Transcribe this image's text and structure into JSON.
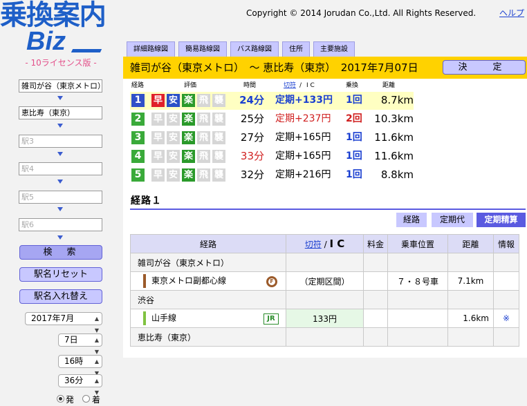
{
  "logo": {
    "main": "乗換案内",
    "sub": "Biz",
    "license": "- 10ライセンス版 -"
  },
  "header": {
    "copyright": "Copyright © 2014 Jorudan Co.,Ltd. All Rights Reserved.",
    "help": "ヘルプ"
  },
  "sidebar": {
    "stations": [
      {
        "value": "雑司が谷（東京メトロ）"
      },
      {
        "value": "恵比寿（東京）"
      },
      {
        "placeholder": "駅3"
      },
      {
        "placeholder": "駅4"
      },
      {
        "placeholder": "駅5"
      },
      {
        "placeholder": "駅6"
      }
    ],
    "buttons": {
      "search": "検　索",
      "reset": "駅名リセット",
      "swap": "駅名入れ替え"
    },
    "date": {
      "year_month": "2017年7月",
      "day": "7日",
      "hour": "16時",
      "minute": "36分"
    },
    "radio": {
      "depart": "発",
      "arrive": "着"
    }
  },
  "tabs": [
    "詳細路線図",
    "簡易路線図",
    "バス路線図",
    "住所",
    "主要施設"
  ],
  "route_bar": {
    "title": "雑司が谷（東京メトロ）　〜 恵比寿（東京）　2017年7月07日",
    "decide": "決　定"
  },
  "results": {
    "headers": {
      "route": "経路",
      "rating": "評価",
      "time": "時間",
      "ticket": "切符",
      "slash": "/",
      "ic": "I C",
      "transfer": "乗換",
      "distance": "距離"
    },
    "badge_labels": [
      "早",
      "安",
      "楽",
      "飛",
      "襲"
    ],
    "rows": [
      {
        "num": "1",
        "badges": [
          true,
          true,
          true,
          false,
          false
        ],
        "time": "24分",
        "fare": "定期+133円",
        "transfers": "1回",
        "distance": "8.7km"
      },
      {
        "num": "2",
        "badges": [
          false,
          false,
          true,
          false,
          false
        ],
        "time": "25分",
        "fare": "定期+237円",
        "transfers": "2回",
        "distance": "10.3km"
      },
      {
        "num": "3",
        "badges": [
          false,
          false,
          true,
          false,
          false
        ],
        "time": "27分",
        "fare": "定期+165円",
        "transfers": "1回",
        "distance": "11.6km"
      },
      {
        "num": "4",
        "badges": [
          false,
          false,
          true,
          false,
          false
        ],
        "time": "33分",
        "fare": "定期+165円",
        "transfers": "1回",
        "distance": "11.6km"
      },
      {
        "num": "5",
        "badges": [
          false,
          false,
          true,
          false,
          false
        ],
        "time": "32分",
        "fare": "定期+216円",
        "transfers": "1回",
        "distance": "8.8km"
      }
    ]
  },
  "route_detail": {
    "heading": "経路１",
    "sub_tabs": [
      "経路",
      "定期代",
      "定期精算"
    ],
    "columns": {
      "route": "経路",
      "ticket": "切符",
      "slash": "/",
      "ic": "I C",
      "surcharge": "料金",
      "car": "乗車位置",
      "distance": "距離",
      "info": "情報"
    },
    "stations": [
      "雑司が谷（東京メトロ）",
      "渋谷",
      "恵比寿（東京）"
    ],
    "segments": [
      {
        "line": "東京メトロ副都心線",
        "icon": "F",
        "fare": "（定期区間）",
        "car": "７・８号車",
        "distance": "7.1km",
        "info": ""
      },
      {
        "line": "山手線",
        "icon": "JR",
        "fare": "133円",
        "car": "",
        "distance": "1.6km",
        "info": "※"
      }
    ]
  },
  "colors": {
    "accent": "#5a5ae0",
    "bar": "#ffd200",
    "metro_fukutoshin": "#9b5a2a",
    "jr_yamanote": "#80c241"
  }
}
